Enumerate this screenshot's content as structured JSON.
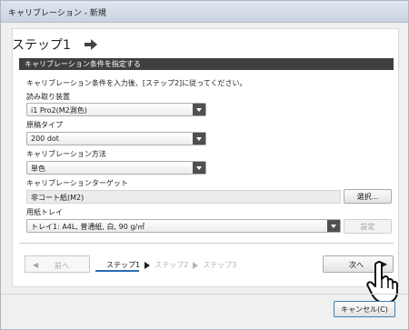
{
  "window": {
    "title": "キャリブレーション - 新規"
  },
  "header": {
    "step_title": "ステップ1"
  },
  "section": {
    "title": "キャリブレーション条件を指定する"
  },
  "instruction": "キャリブレーション条件を入力後、[ステップ2]に従ってください。",
  "fields": {
    "reader": {
      "label": "読み取り装置",
      "value": "i1 Pro2(M2測色)"
    },
    "screen": {
      "label": "原稿タイプ",
      "value": "200 dot"
    },
    "method": {
      "label": "キャリブレーション方法",
      "value": "単色"
    },
    "target": {
      "label": "キャリブレーションターゲット",
      "value": "非コート紙(M2)",
      "select_label": "選択..."
    },
    "tray": {
      "label": "用紙トレイ",
      "value": "トレイ1: A4L, 普通紙, 白, 90 g/㎡",
      "settings_label": "設定"
    }
  },
  "nav": {
    "prev_label": "前へ",
    "next_label": "次へ",
    "steps": [
      "ステップ1",
      "ステップ2",
      "ステップ3"
    ],
    "current_step": 1
  },
  "footer": {
    "cancel_label": "キャンセル(C)"
  },
  "colors": {
    "accent": "#2b6cb0",
    "section_bar": "#3f3f3f"
  }
}
